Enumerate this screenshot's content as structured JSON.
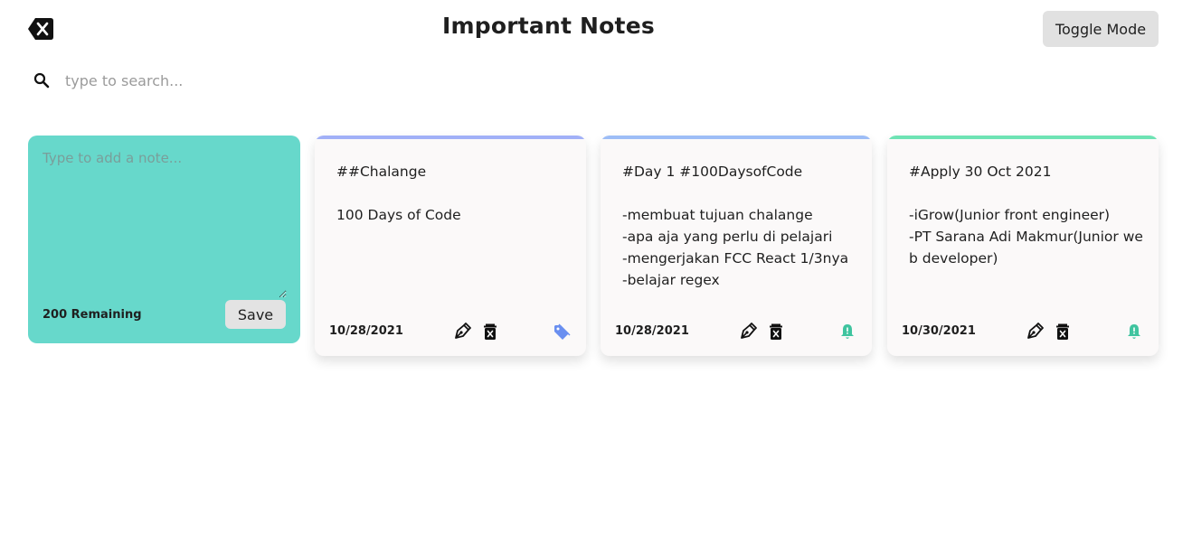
{
  "header": {
    "title": "Important Notes",
    "toggle_label": "Toggle Mode"
  },
  "search": {
    "placeholder": "type to search..."
  },
  "composer": {
    "placeholder": "Type to add a note...",
    "remaining": "200 Remaining",
    "save_label": "Save",
    "background": "#67d8cb"
  },
  "notes": [
    {
      "text": "##Chalange\n\n100 Days of Code",
      "date": "10/28/2021",
      "accent": "#a1b0f7",
      "badge_icon": "tag-icon",
      "badge_color": "#6a8ff0"
    },
    {
      "text": "#Day 1 #100DaysofCode\n\n-membuat tujuan chalange\n-apa aja yang perlu di pelajari\n-mengerjakan FCC React 1/3nya\n-belajar regex",
      "date": "10/28/2021",
      "accent": "#9dbdf6",
      "badge_icon": "bell-icon",
      "badge_color": "#3fc49f"
    },
    {
      "text": "#Apply 30 Oct 2021\n\n-iGrow(Junior front engineer)\n-PT Sarana Adi Makmur(Junior we\nb developer)",
      "date": "10/30/2021",
      "accent": "#6ee3b4",
      "badge_icon": "bell-icon",
      "badge_color": "#3fc49f"
    }
  ]
}
